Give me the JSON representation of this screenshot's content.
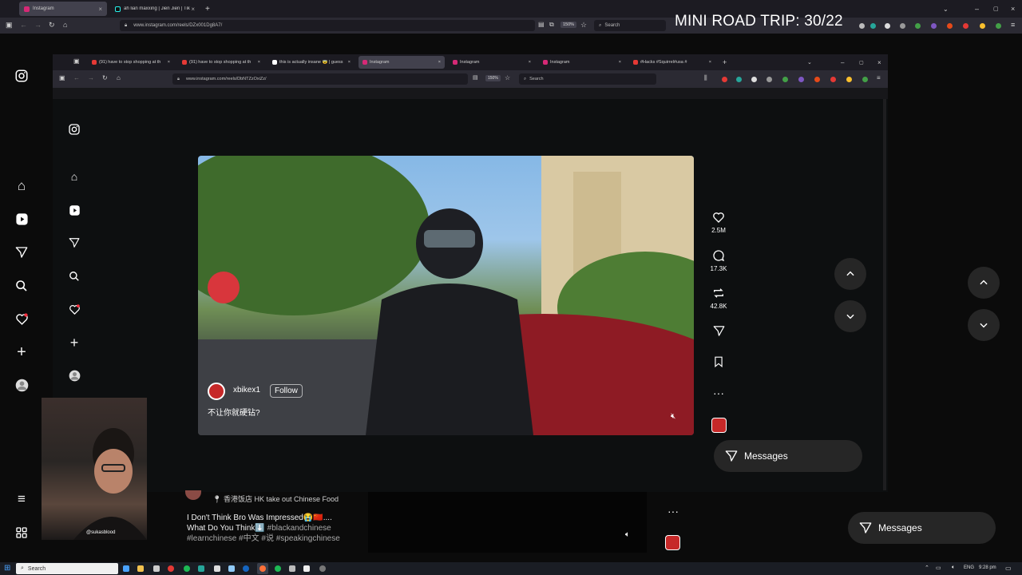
{
  "overlay": {
    "title": "MINI ROAD TRIP: 30/22"
  },
  "outer_browser": {
    "tabs": [
      {
        "label": "Instagram"
      },
      {
        "label": "ah lian maxxing | Jien Jien | TikTo"
      }
    ],
    "new_tab": "+",
    "url": "www.instagram.com/reels/DZx001Dg8A7/",
    "zoom": "150%",
    "search_placeholder": "Search"
  },
  "inner_browser": {
    "tabs": [
      {
        "label": "(91) have to stop shopping at th",
        "color": "#e53935"
      },
      {
        "label": "(91) have to stop shopping at th",
        "color": "#e53935"
      },
      {
        "label": "this is actually insane 😨 | guess",
        "color": "#ffffff"
      },
      {
        "label": "Instagram",
        "color": "#d62976"
      },
      {
        "label": "Instagram",
        "color": "#d62976"
      },
      {
        "label": "Instagram",
        "color": "#d62976"
      },
      {
        "label": "#Hacks #Squirrel#usa #",
        "color": "#e53935"
      }
    ],
    "new_tab": "+",
    "url": "www.instagram.com/reels/DbNTZzOxiZz/",
    "zoom": "150%",
    "search_placeholder": "Search"
  },
  "reel": {
    "username": "xbikex1",
    "follow_label": "Follow",
    "caption": "不让你就硬钻?",
    "likes": "2.5M",
    "comments": "17.3K",
    "reposts": "42.8K"
  },
  "messages_label": "Messages",
  "next_post": {
    "location": "香港饭店 HK take out Chinese Food",
    "caption_line1": "I Don't Think Bro Was Impressed😭🇨🇳....",
    "caption_line2_text": "What Do You Think⬇️",
    "caption_line2_tag": "#blackandchinese",
    "caption_line3": "#learnchinese #中文 #说 #speakingchinese"
  },
  "webcam": {
    "handle": "@sukasblood"
  },
  "taskbar": {
    "search_label": "Search",
    "lang": "ENG",
    "time": "9:28 pm"
  },
  "colors": {
    "accent_red": "#ff3040",
    "pill_bg": "#262626",
    "browser_chrome": "#2b2a33"
  }
}
